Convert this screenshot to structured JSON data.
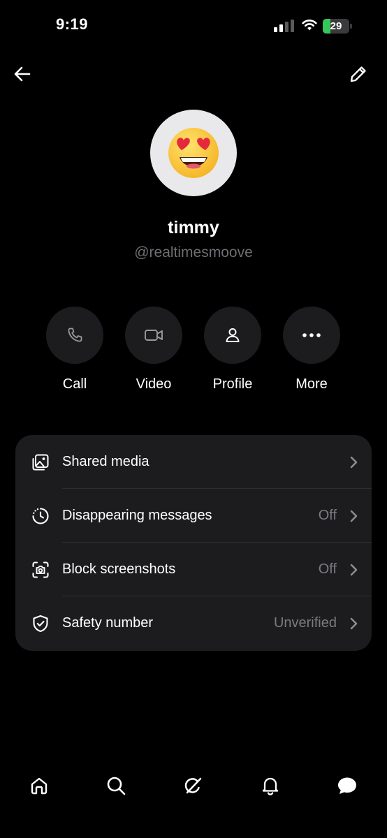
{
  "status_bar": {
    "time": "9:19",
    "battery_percent": 29,
    "battery_label": "29",
    "battery_color": "#34c759"
  },
  "header": {
    "back_icon": "arrow-left-icon",
    "edit_icon": "pencil-icon"
  },
  "profile": {
    "avatar": "heart-eyes-emoji",
    "name": "timmy",
    "handle": "@realtimesmoove"
  },
  "actions": [
    {
      "label": "Call",
      "icon": "phone-icon"
    },
    {
      "label": "Video",
      "icon": "video-camera-icon"
    },
    {
      "label": "Profile",
      "icon": "person-icon"
    },
    {
      "label": "More",
      "icon": "more-dots-icon"
    }
  ],
  "settings": [
    {
      "label": "Shared media",
      "value": "",
      "icon": "media-gallery-icon"
    },
    {
      "label": "Disappearing messages",
      "value": "Off",
      "icon": "timer-icon"
    },
    {
      "label": "Block screenshots",
      "value": "Off",
      "icon": "screenshot-icon"
    },
    {
      "label": "Safety number",
      "value": "Unverified",
      "icon": "shield-check-icon"
    }
  ],
  "tabbar": [
    {
      "icon": "home-icon"
    },
    {
      "icon": "search-icon"
    },
    {
      "icon": "grok-icon"
    },
    {
      "icon": "bell-icon"
    },
    {
      "icon": "messages-icon"
    }
  ],
  "colors": {
    "background": "#000000",
    "surface": "#1c1c1e",
    "secondary_text": "#6e6e73"
  }
}
